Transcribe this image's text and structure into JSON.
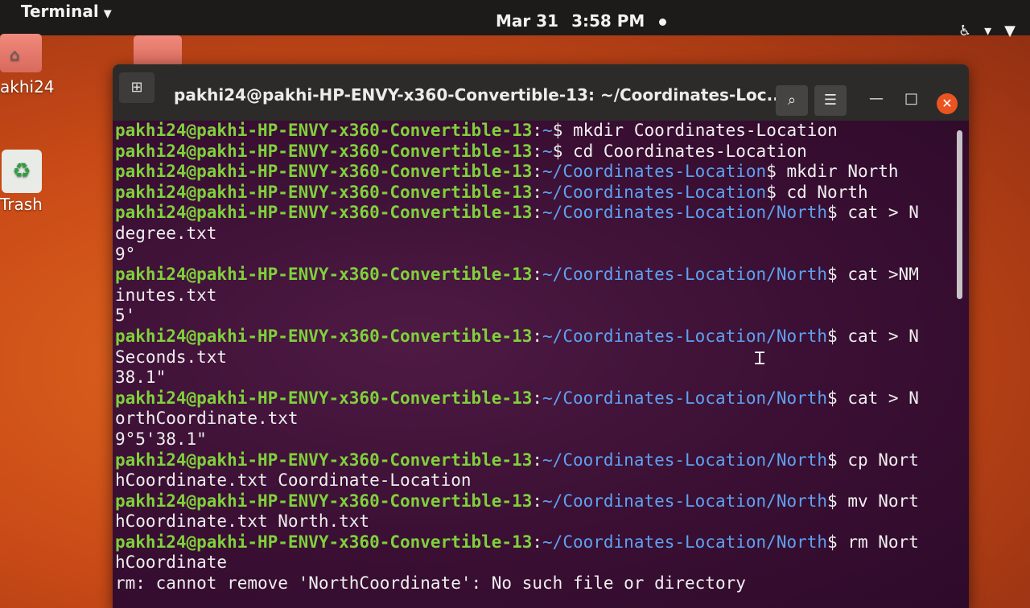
{
  "topbar": {
    "app_menu": "Terminal",
    "date": "Mar 31",
    "time": "3:58 PM"
  },
  "desktop": {
    "home_label": "akhi24",
    "trash_label": "Trash"
  },
  "window": {
    "title": "pakhi24@pakhi-HP-ENVY-x360-Convertible-13: ~/Coordinates-Loc..."
  },
  "terminal": {
    "user_host": "pakhi24@pakhi-HP-ENVY-x360-Convertible-13",
    "lines": [
      {
        "type": "prompt",
        "path": "~",
        "cmd": " mkdir Coordinates-Location"
      },
      {
        "type": "prompt",
        "path": "~",
        "cmd": " cd Coordinates-Location"
      },
      {
        "type": "prompt",
        "path": "~/Coordinates-Location",
        "cmd": " mkdir North"
      },
      {
        "type": "prompt",
        "path": "~/Coordinates-Location",
        "cmd": " cd North"
      },
      {
        "type": "prompt",
        "path": "~/Coordinates-Location/North",
        "cmd": " cat > N"
      },
      {
        "type": "output",
        "text": "degree.txt"
      },
      {
        "type": "output",
        "text": "9°"
      },
      {
        "type": "prompt",
        "path": "~/Coordinates-Location/North",
        "cmd": " cat >NM"
      },
      {
        "type": "output",
        "text": "inutes.txt"
      },
      {
        "type": "output",
        "text": "5'"
      },
      {
        "type": "prompt",
        "path": "~/Coordinates-Location/North",
        "cmd": " cat > N"
      },
      {
        "type": "output",
        "text": "Seconds.txt"
      },
      {
        "type": "output",
        "text": "38.1\""
      },
      {
        "type": "prompt",
        "path": "~/Coordinates-Location/North",
        "cmd": " cat > N"
      },
      {
        "type": "output",
        "text": "orthCoordinate.txt"
      },
      {
        "type": "output",
        "text": "9°5'38.1\""
      },
      {
        "type": "prompt",
        "path": "~/Coordinates-Location/North",
        "cmd": " cp Nort"
      },
      {
        "type": "output",
        "text": "hCoordinate.txt Coordinate-Location"
      },
      {
        "type": "prompt",
        "path": "~/Coordinates-Location/North",
        "cmd": " mv Nort"
      },
      {
        "type": "output",
        "text": "hCoordinate.txt North.txt"
      },
      {
        "type": "prompt",
        "path": "~/Coordinates-Location/North",
        "cmd": " rm Nort"
      },
      {
        "type": "output",
        "text": "hCoordinate"
      },
      {
        "type": "output",
        "text": "rm: cannot remove 'NorthCoordinate': No such file or directory"
      }
    ]
  }
}
